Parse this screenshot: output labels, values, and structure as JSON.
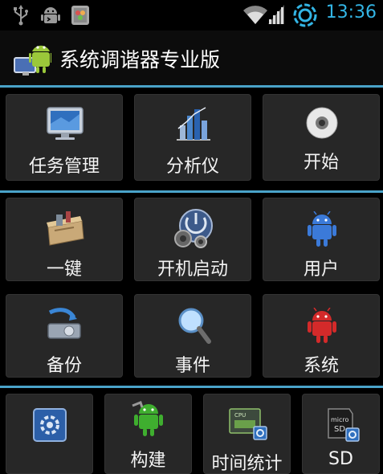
{
  "status_bar": {
    "time": "13:36",
    "icons": [
      "usb-icon",
      "android-debug-icon",
      "app-notification-icon",
      "wifi-icon",
      "signal-icon",
      "sync-icon"
    ],
    "accent": "#33b5e5"
  },
  "app": {
    "title": "系统调谐器专业版",
    "separator_color": "#4aa3c9"
  },
  "grid": {
    "row1": [
      "任务管理",
      "分析仪",
      "开始"
    ],
    "row2": [
      "一键",
      "开机启动",
      "用户"
    ],
    "row3": [
      "备份",
      "事件",
      "系统"
    ],
    "row4": [
      "",
      "构建",
      "时间统计",
      "SD"
    ]
  }
}
